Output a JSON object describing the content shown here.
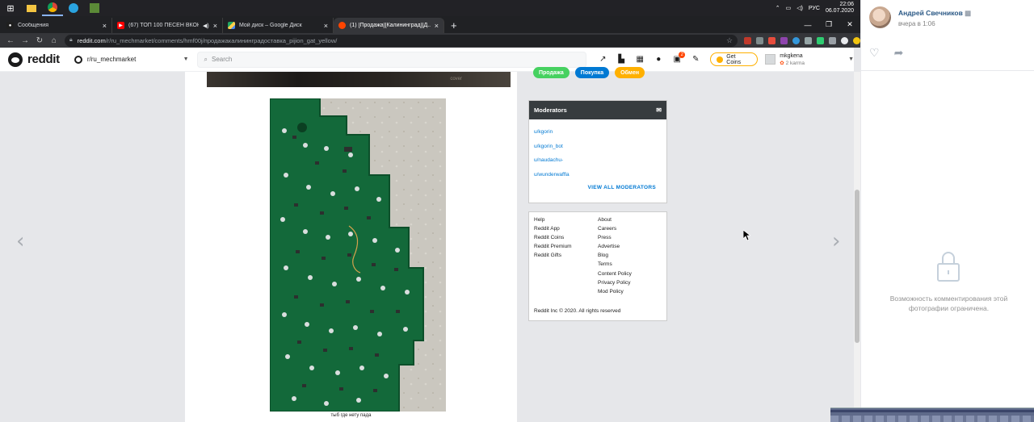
{
  "taskbar": {
    "tray_lang": "РУС",
    "time": "22:06",
    "date": "06.07.2020"
  },
  "browser": {
    "tabs": [
      {
        "title": "Сообщения",
        "favicon_color": "#1f1f1f",
        "active": false
      },
      {
        "title": "(67) ТОП 100 ПЕСЕН ВКОНТ",
        "favicon_color": "#ff0000",
        "active": false
      },
      {
        "title": "Мой диск – Google Диск",
        "favicon_color": "#1fa463",
        "active": false
      },
      {
        "title": "(1) [Продажа][Калининград][Д...",
        "favicon_color": "#ff4500",
        "active": true
      }
    ],
    "url_host": "reddit.com",
    "url_path": "/r/ru_mechmarket/comments/hmf00j/продажакалининградоставка_pijion_gat_yellow/"
  },
  "reddit": {
    "logo_text": "reddit",
    "community": "r/ru_mechmarket",
    "search_placeholder": "Search",
    "coins_label": "Get Coins",
    "username": "mkgkena",
    "karma": "2 karma",
    "notifications": "2",
    "post": {
      "prev_image_overlay": "cover",
      "caption": "тыб где нету пада"
    },
    "flairs": [
      {
        "label": "Продажа",
        "color": "#46d160"
      },
      {
        "label": "Покупка",
        "color": "#0079d3"
      },
      {
        "label": "Обмен",
        "color": "#ffb000"
      }
    ],
    "moderators": {
      "title": "Moderators",
      "items": [
        "u/kgorin",
        "u/kgorin_bot",
        "u/naudachu-",
        "u/wunderwaffla"
      ],
      "view_all": "VIEW ALL MODERATORS"
    },
    "footer": {
      "col1": [
        "Help",
        "Reddit App",
        "Reddit Coins",
        "Reddit Premium",
        "Reddit Gifts"
      ],
      "col2": [
        "About",
        "Careers",
        "Press",
        "Advertise",
        "Blog",
        "Terms",
        "Content Policy",
        "Privacy Policy",
        "Mod Policy"
      ],
      "copyright": "Reddit Inc © 2020. All rights reserved"
    }
  },
  "viewer": {
    "prev_arrow": "‹",
    "next_arrow": "›"
  },
  "vk": {
    "author": "Андрей Свечников",
    "time": "вчера в 1:06",
    "restricted_message": "Возможность комментирования этой фотографии ограничена."
  }
}
